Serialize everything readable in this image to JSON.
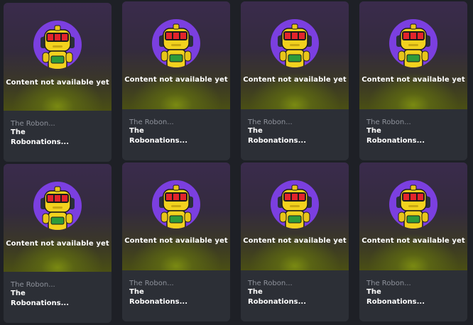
{
  "colors": {
    "page_background": "#1e2026",
    "card_background": "#2c2f36",
    "subtitle_text": "#8e929b",
    "title_text": "#ffffff"
  },
  "placeholder_image": "robot-mascot-icon",
  "cards": [
    {
      "collection": "The Robon...",
      "title_line1": "The",
      "title_line2": "Robonations...",
      "placeholder_text": "Content not available yet"
    },
    {
      "collection": "The Robon...",
      "title_line1": "The",
      "title_line2": "Robonations...",
      "placeholder_text": "Content not available yet"
    },
    {
      "collection": "The Robon...",
      "title_line1": "The",
      "title_line2": "Robonations...",
      "placeholder_text": "Content not available yet"
    },
    {
      "collection": "The Robon...",
      "title_line1": "The",
      "title_line2": "Robonations...",
      "placeholder_text": "Content not available yet"
    },
    {
      "collection": "The Robon...",
      "title_line1": "The",
      "title_line2": "Robonations...",
      "placeholder_text": "Content not available yet"
    },
    {
      "collection": "The Robon...",
      "title_line1": "The",
      "title_line2": "Robonations...",
      "placeholder_text": "Content not available yet"
    },
    {
      "collection": "The Robon...",
      "title_line1": "The",
      "title_line2": "Robonations...",
      "placeholder_text": "Content not available yet"
    },
    {
      "collection": "The Robon...",
      "title_line1": "The",
      "title_line2": "Robonations...",
      "placeholder_text": "Content not available yet"
    }
  ]
}
